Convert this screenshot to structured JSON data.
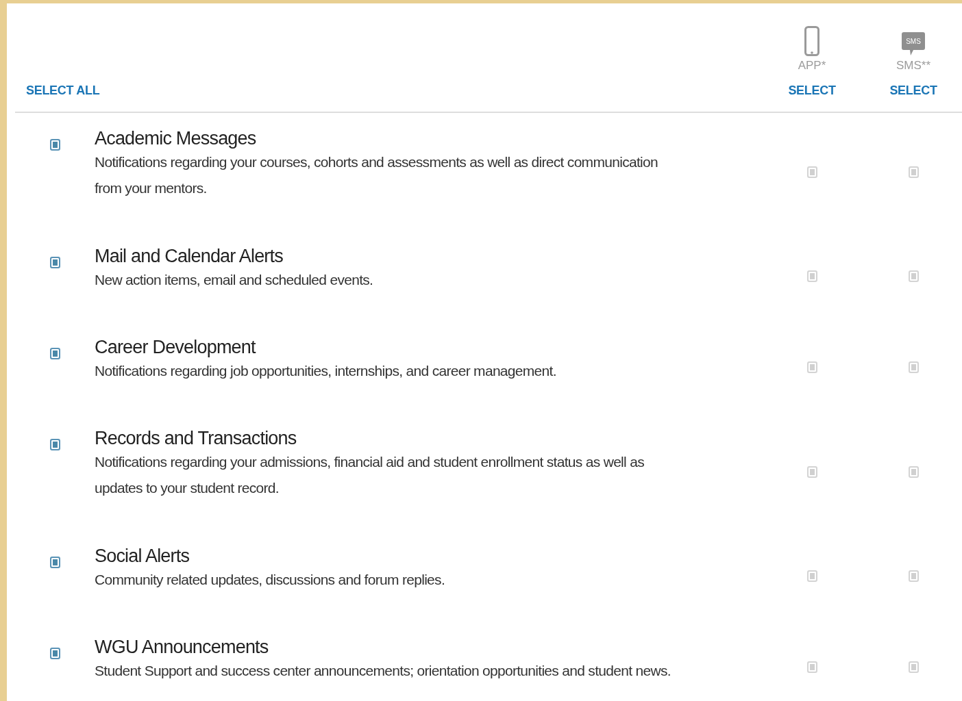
{
  "header": {
    "select_all": "SELECT ALL",
    "channels": [
      {
        "label": "APP*",
        "select": "SELECT"
      },
      {
        "label": "SMS**",
        "select": "SELECT",
        "icon_text": "SMS"
      }
    ]
  },
  "categories": [
    {
      "title": "Academic Messages",
      "description": "Notifications regarding your courses, cohorts and assessments as well as direct communication from your mentors.",
      "email": {
        "checked": true,
        "disabled": false
      },
      "app": {
        "checked": false,
        "disabled": true
      },
      "sms": {
        "checked": false,
        "disabled": true
      }
    },
    {
      "title": "Mail and Calendar Alerts",
      "description": "New action items, email and scheduled events.",
      "email": {
        "checked": true,
        "disabled": false
      },
      "app": {
        "checked": false,
        "disabled": true
      },
      "sms": {
        "checked": false,
        "disabled": true
      }
    },
    {
      "title": "Career Development",
      "description": "Notifications regarding job opportunities, internships, and career management.",
      "email": {
        "checked": true,
        "disabled": false
      },
      "app": {
        "checked": false,
        "disabled": true
      },
      "sms": {
        "checked": false,
        "disabled": true
      }
    },
    {
      "title": "Records and Transactions",
      "description": "Notifications regarding your admissions, financial aid and student enrollment status as well as updates to your student record.",
      "email": {
        "checked": true,
        "disabled": false
      },
      "app": {
        "checked": false,
        "disabled": true
      },
      "sms": {
        "checked": false,
        "disabled": true
      }
    },
    {
      "title": "Social Alerts",
      "description": "Community related updates, discussions and forum replies.",
      "email": {
        "checked": true,
        "disabled": false
      },
      "app": {
        "checked": false,
        "disabled": true
      },
      "sms": {
        "checked": false,
        "disabled": true
      }
    },
    {
      "title": "WGU Announcements",
      "description": "Student Support and success center announcements; orientation opportunities and student news.",
      "email": {
        "checked": true,
        "disabled": false
      },
      "app": {
        "checked": false,
        "disabled": true
      },
      "sms": {
        "checked": false,
        "disabled": true
      }
    }
  ]
}
